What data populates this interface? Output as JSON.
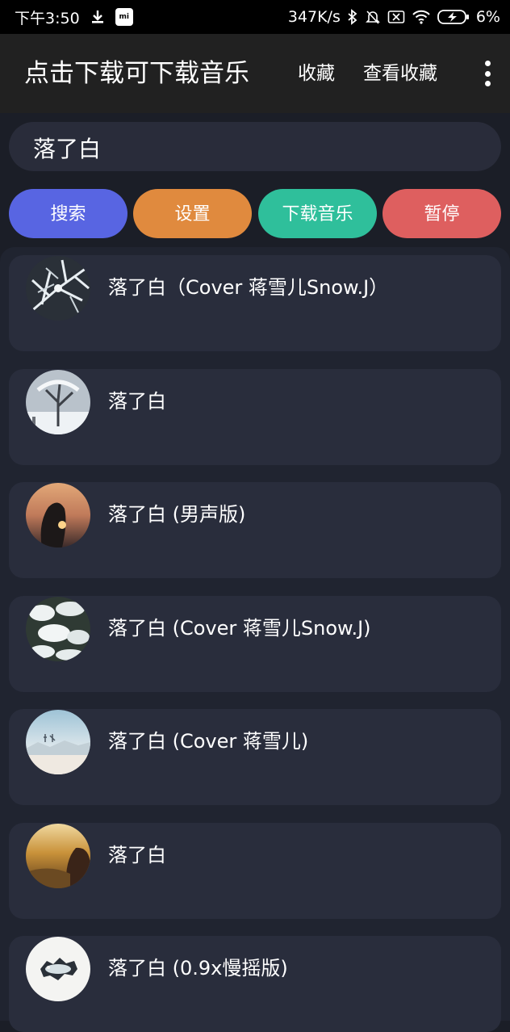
{
  "status_bar": {
    "time": "下午3:50",
    "mi_badge": "mi",
    "net_speed": "347K/s",
    "battery": "6%"
  },
  "app_bar": {
    "title": "点击下载可下载音乐",
    "favorite_label": "收藏",
    "view_favorites_label": "查看收藏"
  },
  "search": {
    "value": "落了白"
  },
  "buttons": {
    "search": "搜索",
    "settings": "设置",
    "download": "下载音乐",
    "pause": "暂停"
  },
  "colors": {
    "search_button": "#5865e2",
    "settings_button": "#e08a3e",
    "download_button": "#2fbf9b",
    "pause_button": "#de5f5f"
  },
  "songs": [
    {
      "title": "落了白（Cover 蒋雪儿Snow.J）",
      "cover": "snowy-branches-cover"
    },
    {
      "title": "落了白",
      "cover": "snowy-tree-cover"
    },
    {
      "title": "落了白 (男声版)",
      "cover": "sunset-portrait-cover"
    },
    {
      "title": "落了白 (Cover 蒋雪儿Snow.J)",
      "cover": "snow-covered-plant-cover"
    },
    {
      "title": "落了白 (Cover 蒋雪儿)",
      "cover": "winter-landscape-cover"
    },
    {
      "title": "落了白",
      "cover": "autumn-girl-cover"
    },
    {
      "title": "落了白 (0.9x慢摇版)",
      "cover": "ink-splash-cover"
    }
  ]
}
